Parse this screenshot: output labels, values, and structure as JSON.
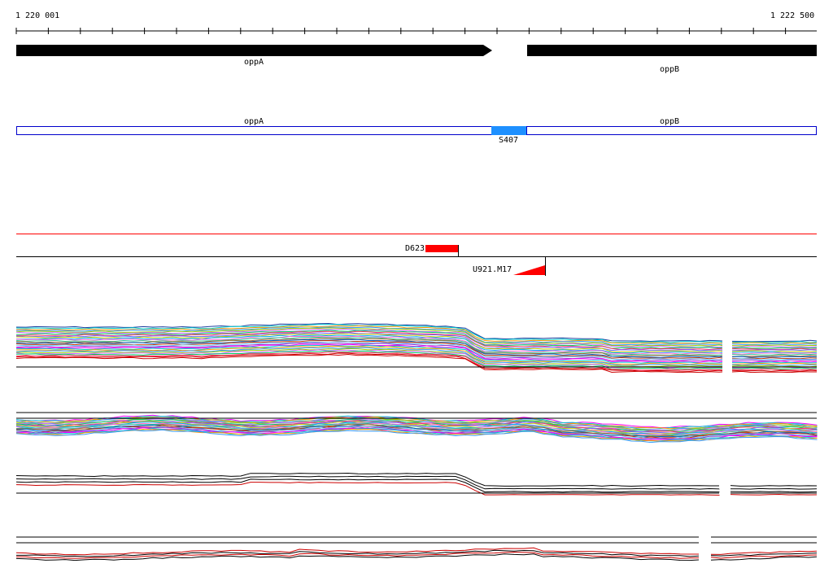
{
  "coords": {
    "start": "1 220 001",
    "end": "1 222 500"
  },
  "genes": [
    {
      "name": "oppA",
      "strand": "+"
    },
    {
      "name": "oppB",
      "strand": "+"
    }
  ],
  "annotation_track": {
    "features": [
      {
        "name": "oppA",
        "kind": "cds"
      },
      {
        "name": "S407",
        "kind": "segment",
        "color": "#1e90ff"
      },
      {
        "name": "oppB",
        "kind": "cds"
      }
    ]
  },
  "features": [
    {
      "name": "D623",
      "color": "#ff0000"
    },
    {
      "name": "U921.M17",
      "color": "#ff0000"
    }
  ],
  "colors": {
    "gene_arrow": "#000000",
    "annotation_border": "#0000cc",
    "segment_fill": "#1e90ff",
    "threshold_line": "#ff0000",
    "feature": "#ff0000"
  }
}
